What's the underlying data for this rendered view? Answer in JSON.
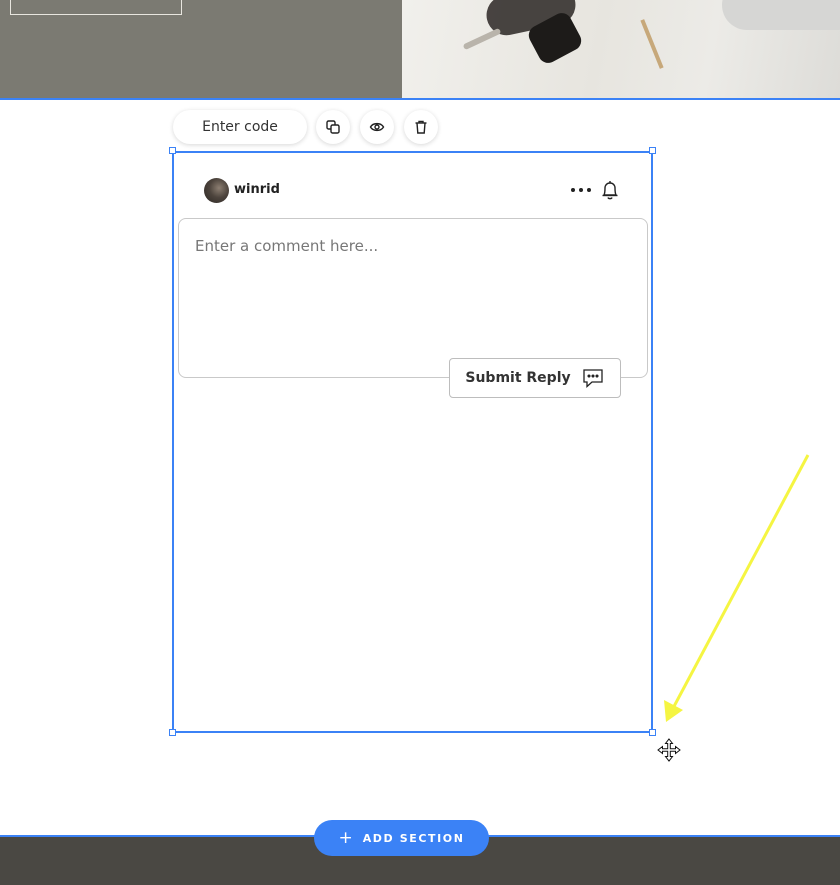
{
  "toolbar": {
    "enter_code_label": "Enter code",
    "icons": [
      "duplicate-icon",
      "eye-icon",
      "trash-icon"
    ]
  },
  "comment_widget": {
    "username": "winrid",
    "comment_placeholder": "Enter a comment here...",
    "submit_label": "Submit Reply",
    "icons": [
      "more-icon",
      "bell-icon",
      "chat-bubble-icon"
    ]
  },
  "add_section": {
    "plus": "+",
    "label": "ADD SECTION"
  },
  "colors": {
    "selection": "#3b82f6",
    "annotation_arrow": "#f5f542",
    "footer": "#4a4843",
    "hero_left": "#7b7a72"
  }
}
